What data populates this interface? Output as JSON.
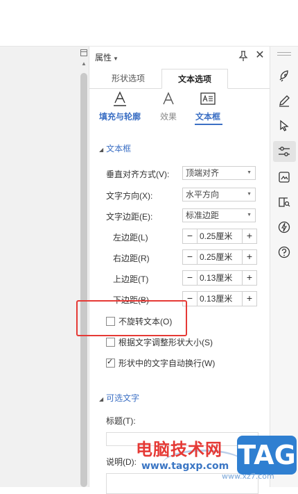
{
  "panel": {
    "title": "属性",
    "tabs": [
      {
        "label": "形状选项"
      },
      {
        "label": "文本选项"
      }
    ],
    "subtabs": [
      {
        "label": "填充与轮廓"
      },
      {
        "label": "效果"
      },
      {
        "label": "文本框"
      }
    ]
  },
  "textbox_section": {
    "title": "文本框",
    "vertical_align": {
      "label": "垂直对齐方式(V):",
      "value": "顶端对齐"
    },
    "text_direction": {
      "label": "文字方向(X):",
      "value": "水平方向"
    },
    "text_margin": {
      "label": "文字边距(E):",
      "value": "标准边距"
    },
    "margins": [
      {
        "label": "左边距(L)",
        "value": "0.25厘米"
      },
      {
        "label": "右边距(R)",
        "value": "0.25厘米"
      },
      {
        "label": "上边距(T)",
        "value": "0.13厘米"
      },
      {
        "label": "下边距(B)",
        "value": "0.13厘米"
      }
    ],
    "checkboxes": [
      {
        "label": "不旋转文本(O)",
        "checked": false
      },
      {
        "label": "根据文字调整形状大小(S)",
        "checked": false
      },
      {
        "label": "形状中的文字自动换行(W)",
        "checked": true
      }
    ]
  },
  "alt_text_section": {
    "title": "可选文字",
    "title_label": "标题(T):",
    "desc_label": "说明(D):"
  },
  "stepper": {
    "minus": "−",
    "plus": "+"
  },
  "watermark": {
    "site_name": "电脑技术网",
    "site_url": "www.tagxp.com",
    "tag": "TAG",
    "url2": "www.xz7.com"
  },
  "colors": {
    "accent": "#3b6fc4",
    "highlight": "#e53935"
  }
}
